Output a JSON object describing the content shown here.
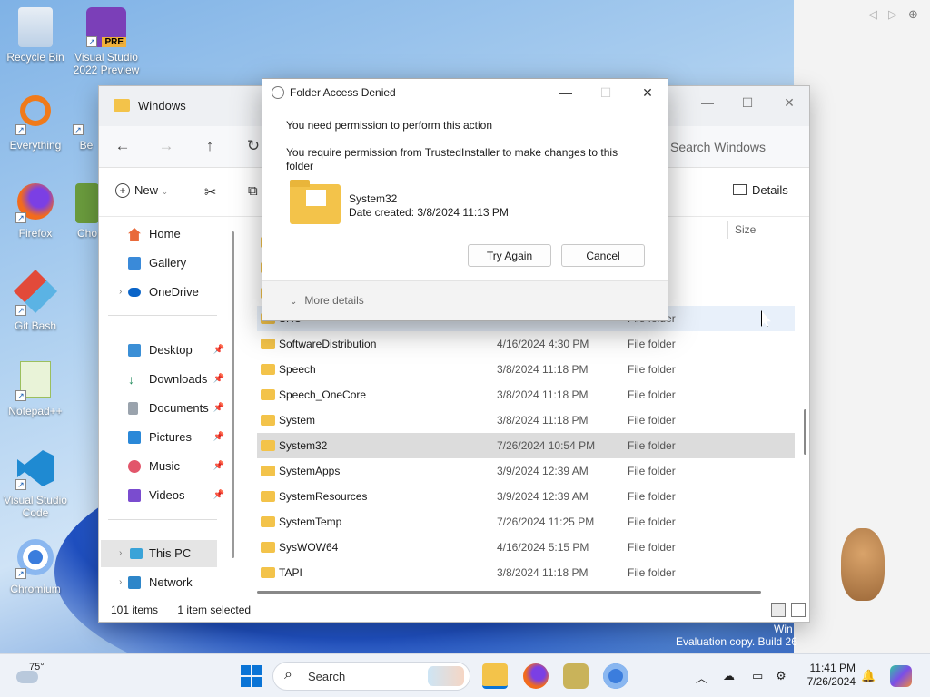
{
  "desktop": {
    "icons": [
      {
        "label": "Recycle Bin"
      },
      {
        "label": "Visual Studio 2022 Preview"
      },
      {
        "label": "Everything"
      },
      {
        "label": "Be"
      },
      {
        "label": "Firefox"
      },
      {
        "label": "Cho"
      },
      {
        "label": "Git Bash"
      },
      {
        "label": "Notepad++"
      },
      {
        "label": "Visual Studio Code"
      },
      {
        "label": "Chromium"
      }
    ],
    "pre_badge": "PRE",
    "watermark_line1": "Win",
    "watermark_line2": "Evaluation copy. Build 26"
  },
  "explorer": {
    "title": "Windows",
    "search_placeholder": "Search Windows",
    "toolbar": {
      "new_label": "New",
      "details_label": "Details"
    },
    "sidebar": {
      "items": [
        {
          "label": "Home"
        },
        {
          "label": "Gallery"
        },
        {
          "label": "OneDrive"
        },
        {
          "label": "Desktop"
        },
        {
          "label": "Downloads"
        },
        {
          "label": "Documents"
        },
        {
          "label": "Pictures"
        },
        {
          "label": "Music"
        },
        {
          "label": "Videos"
        },
        {
          "label": "This PC"
        },
        {
          "label": "Network"
        }
      ]
    },
    "columns": {
      "size": "Size"
    },
    "partial_rows": [
      {
        "type": "older"
      },
      {
        "type": "older"
      },
      {
        "type": "older"
      },
      {
        "name": "SRU",
        "type": "File folder"
      }
    ],
    "files": [
      {
        "name": "SoftwareDistribution",
        "date": "4/16/2024 4:30 PM",
        "type": "File folder"
      },
      {
        "name": "Speech",
        "date": "3/8/2024 11:18 PM",
        "type": "File folder"
      },
      {
        "name": "Speech_OneCore",
        "date": "3/8/2024 11:18 PM",
        "type": "File folder"
      },
      {
        "name": "System",
        "date": "3/8/2024 11:18 PM",
        "type": "File folder"
      },
      {
        "name": "System32",
        "date": "7/26/2024 10:54 PM",
        "type": "File folder"
      },
      {
        "name": "SystemApps",
        "date": "3/9/2024 12:39 AM",
        "type": "File folder"
      },
      {
        "name": "SystemResources",
        "date": "3/9/2024 12:39 AM",
        "type": "File folder"
      },
      {
        "name": "SystemTemp",
        "date": "7/26/2024 11:25 PM",
        "type": "File folder"
      },
      {
        "name": "SysWOW64",
        "date": "4/16/2024 5:15 PM",
        "type": "File folder"
      },
      {
        "name": "TAPI",
        "date": "3/8/2024 11:18 PM",
        "type": "File folder"
      }
    ],
    "status": {
      "count": "101 items",
      "selected": "1 item selected"
    }
  },
  "dialog": {
    "title": "Folder Access Denied",
    "message1": "You need permission to perform this action",
    "message2": "You require permission from TrustedInstaller to make changes to this folder",
    "folder_name": "System32",
    "folder_date": "Date created: 3/8/2024 11:13 PM",
    "try_again": "Try Again",
    "cancel": "Cancel",
    "more_details": "More details"
  },
  "taskbar": {
    "weather_temp": "75°",
    "search_label": "Search",
    "time": "11:41 PM",
    "date": "7/26/2024"
  },
  "colors": {
    "accent": "#0067c0",
    "folder": "#f3c34a",
    "selected_row": "#dcdcdc"
  }
}
